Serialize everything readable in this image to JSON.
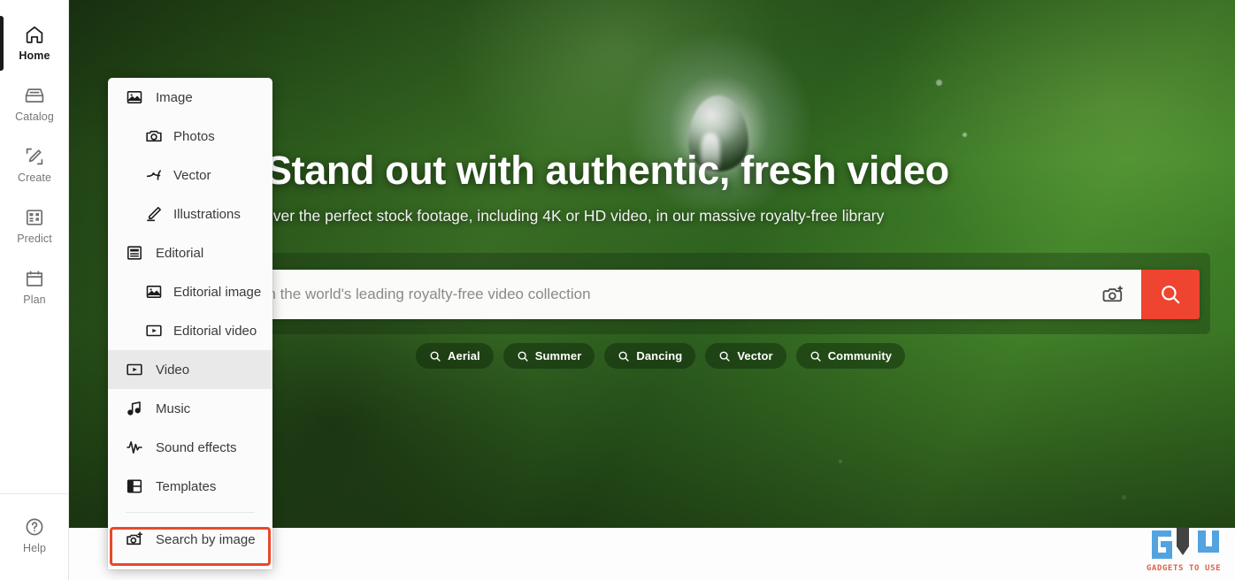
{
  "sidebar": {
    "items": [
      {
        "label": "Home",
        "icon": "home-icon",
        "active": true
      },
      {
        "label": "Catalog",
        "icon": "catalog-icon",
        "active": false
      },
      {
        "label": "Create",
        "icon": "create-icon",
        "active": false
      },
      {
        "label": "Predict",
        "icon": "predict-icon",
        "active": false
      },
      {
        "label": "Plan",
        "icon": "plan-icon",
        "active": false
      }
    ],
    "help": {
      "label": "Help",
      "icon": "help-circle-icon"
    }
  },
  "menu": {
    "items": [
      {
        "label": "Image",
        "icon": "image-icon",
        "level": 1,
        "selected": false
      },
      {
        "label": "Photos",
        "icon": "camera-icon",
        "level": 2,
        "selected": false
      },
      {
        "label": "Vector",
        "icon": "vector-icon",
        "level": 2,
        "selected": false
      },
      {
        "label": "Illustrations",
        "icon": "pen-icon",
        "level": 2,
        "selected": false
      },
      {
        "label": "Editorial",
        "icon": "article-icon",
        "level": 1,
        "selected": false
      },
      {
        "label": "Editorial image",
        "icon": "image-icon",
        "level": 2,
        "selected": false
      },
      {
        "label": "Editorial video",
        "icon": "play-box-icon",
        "level": 2,
        "selected": false
      },
      {
        "label": "Video",
        "icon": "play-box-icon",
        "level": 1,
        "selected": true
      },
      {
        "label": "Music",
        "icon": "music-note-icon",
        "level": 1,
        "selected": false
      },
      {
        "label": "Sound effects",
        "icon": "waveform-icon",
        "level": 1,
        "selected": false
      },
      {
        "label": "Templates",
        "icon": "templates-icon",
        "level": 1,
        "selected": false
      }
    ],
    "search_by_image": {
      "label": "Search by image",
      "icon": "camera-plus-icon"
    }
  },
  "hero": {
    "headline": "Stand out with authentic, fresh video",
    "subheadline": "Discover the perfect stock footage, including 4K or HD video, in our massive royalty-free library"
  },
  "search": {
    "value": "",
    "placeholder": "Search the world's leading royalty-free video collection",
    "camera_icon": "camera-plus-icon",
    "submit_icon": "search-icon",
    "submit_color": "#ee4430"
  },
  "chips": [
    {
      "label": "Aerial",
      "icon": "search-icon"
    },
    {
      "label": "Summer",
      "icon": "search-icon"
    },
    {
      "label": "Dancing",
      "icon": "search-icon"
    },
    {
      "label": "Vector",
      "icon": "search-icon"
    },
    {
      "label": "Community",
      "icon": "search-icon"
    }
  ],
  "annotation": {
    "color": "#e8492b",
    "target": "Search by image"
  },
  "watermark": {
    "text": "GADGETS TO USE",
    "mark": "G U"
  },
  "colors": {
    "accent_red": "#ee4430",
    "annotation_red": "#e8492b",
    "hero_green_dark": "#1e3c14",
    "hero_green_light": "#49902d",
    "menu_bg": "#fbfbfb",
    "menu_selected": "#e9e9e9"
  }
}
